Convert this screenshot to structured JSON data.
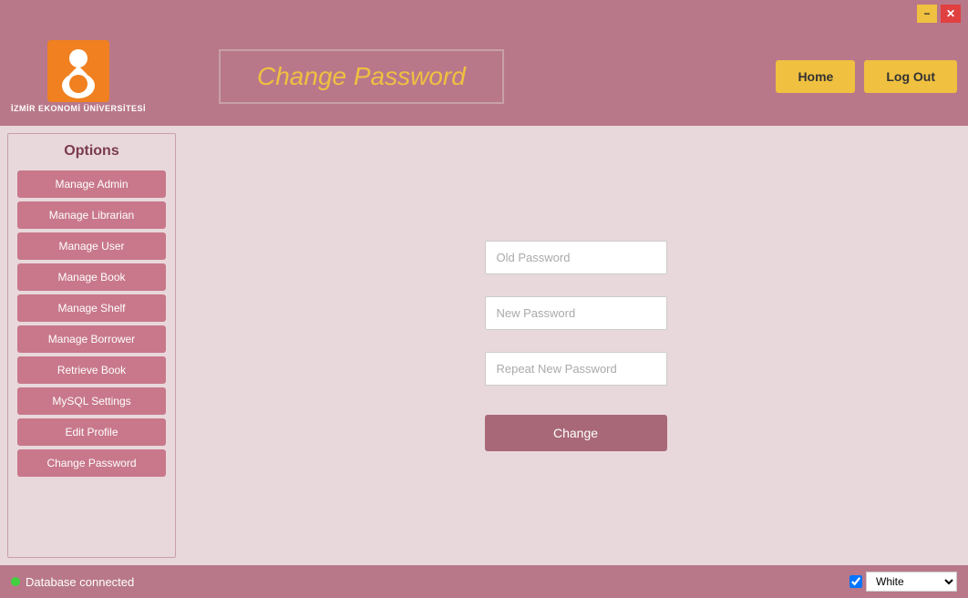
{
  "titlebar": {
    "minimize_label": "−",
    "close_label": "✕"
  },
  "header": {
    "university_name": "İZMİR EKONOMİ ÜNİVERSİTESİ",
    "page_title": "Change Password",
    "home_label": "Home",
    "logout_label": "Log Out"
  },
  "sidebar": {
    "title": "Options",
    "items": [
      {
        "label": "Manage Admin"
      },
      {
        "label": "Manage Librarian"
      },
      {
        "label": "Manage User"
      },
      {
        "label": "Manage Book"
      },
      {
        "label": "Manage Shelf"
      },
      {
        "label": "Manage Borrower"
      },
      {
        "label": "Retrieve Book"
      },
      {
        "label": "MySQL Settings"
      },
      {
        "label": "Edit Profile"
      },
      {
        "label": "Change Password"
      }
    ]
  },
  "form": {
    "old_password_placeholder": "Old Password",
    "new_password_placeholder": "New Password",
    "repeat_password_placeholder": "Repeat New Password",
    "change_label": "Change"
  },
  "statusbar": {
    "db_status": "Database connected",
    "theme_label": "White"
  }
}
